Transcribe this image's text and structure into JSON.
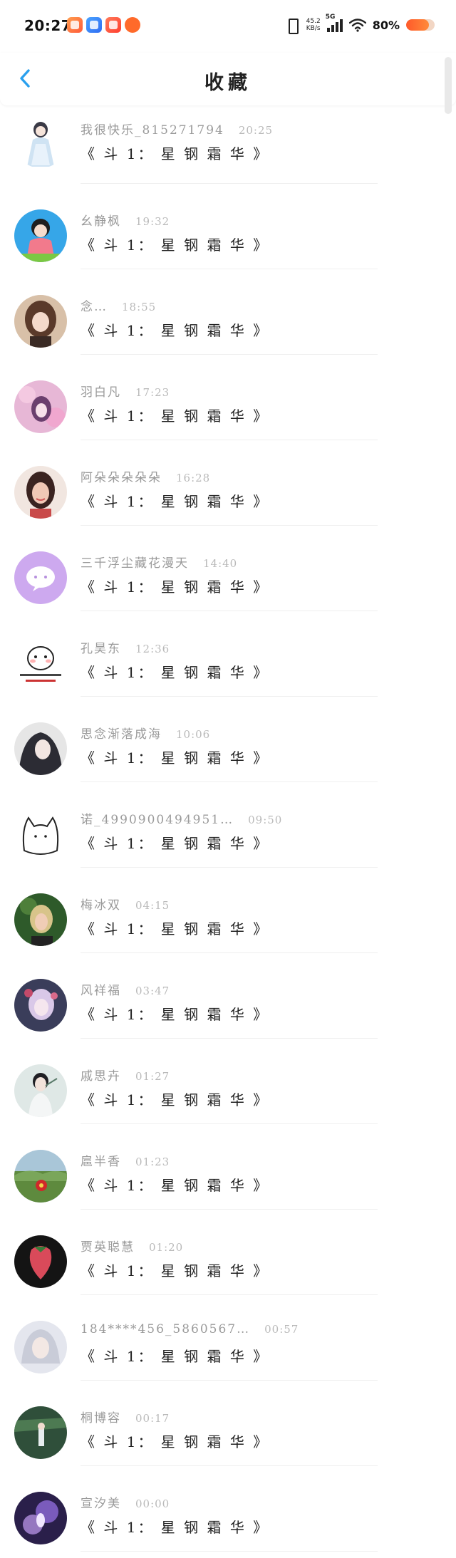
{
  "status_bar": {
    "time": "20:27",
    "net_speed_value": "45.2",
    "net_speed_unit": "KB/s",
    "network_type": "5G",
    "battery_percent": "80%",
    "battery_level": 0.8,
    "apps": [
      "orange-app-icon",
      "blue-app-icon",
      "red-app-icon",
      "pumpkin-app-icon"
    ]
  },
  "header": {
    "back_icon": "chevron-left-icon",
    "title": "收藏"
  },
  "colors": {
    "accent": "#2aa0ee",
    "sender_text": "#9a9a9a",
    "time_text": "#b9b9b9",
    "body_text": "#222222"
  },
  "messages": [
    {
      "sender": "我很快乐_815271794",
      "time": "20:25",
      "content": "《 斗 1： 星 钢 霜 华 》",
      "avatar": "anime-girl-white-dress-avatar"
    },
    {
      "sender": "幺静枫",
      "time": "19:32",
      "content": "《 斗 1： 星 钢 霜 华 》",
      "avatar": "cartoon-pink-dress-avatar"
    },
    {
      "sender": "念…",
      "time": "18:55",
      "content": "《 斗 1： 星 钢 霜 华 》",
      "avatar": "anime-girl-brown-hair-avatar"
    },
    {
      "sender": "羽白凡",
      "time": "17:23",
      "content": "《 斗 1： 星 钢 霜 华 》",
      "avatar": "pink-floral-girl-avatar"
    },
    {
      "sender": "阿朵朵朵朵朵",
      "time": "16:28",
      "content": "《 斗 1： 星 钢 霜 华 》",
      "avatar": "photo-girl-avatar"
    },
    {
      "sender": "三千浮尘藏花漫天",
      "time": "14:40",
      "content": "《 斗 1： 星 钢 霜 华 》",
      "avatar": "purple-chat-bubble-avatar"
    },
    {
      "sender": "孔昊东",
      "time": "12:36",
      "content": "《 斗 1： 星 钢 霜 华 》",
      "avatar": "meme-face-avatar"
    },
    {
      "sender": "思念渐落成海",
      "time": "10:06",
      "content": "《 斗 1： 星 钢 霜 华 》",
      "avatar": "anime-dark-hair-avatar"
    },
    {
      "sender": "诺_4990900494951…",
      "time": "09:50",
      "content": "《 斗 1： 星 钢 霜 华 》",
      "avatar": "sketch-cat-avatar"
    },
    {
      "sender": "梅冰双",
      "time": "04:15",
      "content": "《 斗 1： 星 钢 霜 华 》",
      "avatar": "photo-blonde-avatar"
    },
    {
      "sender": "风祥福",
      "time": "03:47",
      "content": "《 斗 1： 星 钢 霜 华 》",
      "avatar": "fantasy-girl-avatar"
    },
    {
      "sender": "戚思卉",
      "time": "01:27",
      "content": "《 斗 1： 星 钢 霜 华 》",
      "avatar": "ancient-style-man-avatar"
    },
    {
      "sender": "扈半香",
      "time": "01:23",
      "content": "《 斗 1： 星 钢 霜 华 》",
      "avatar": "landscape-red-flower-avatar"
    },
    {
      "sender": "贾英聪慧",
      "time": "01:20",
      "content": "《 斗 1： 星 钢 霜 华 》",
      "avatar": "strawberry-avatar"
    },
    {
      "sender": "184****456_5860567…",
      "time": "00:57",
      "content": "《 斗 1： 星 钢 霜 华 》",
      "avatar": "silver-hair-man-avatar"
    },
    {
      "sender": "桐博容",
      "time": "00:17",
      "content": "《 斗 1： 星 钢 霜 华 》",
      "avatar": "forest-girl-avatar"
    },
    {
      "sender": "宣汐美",
      "time": "00:00",
      "content": "《 斗 1： 星 钢 霜 华 》",
      "avatar": "purple-light-avatar"
    }
  ]
}
